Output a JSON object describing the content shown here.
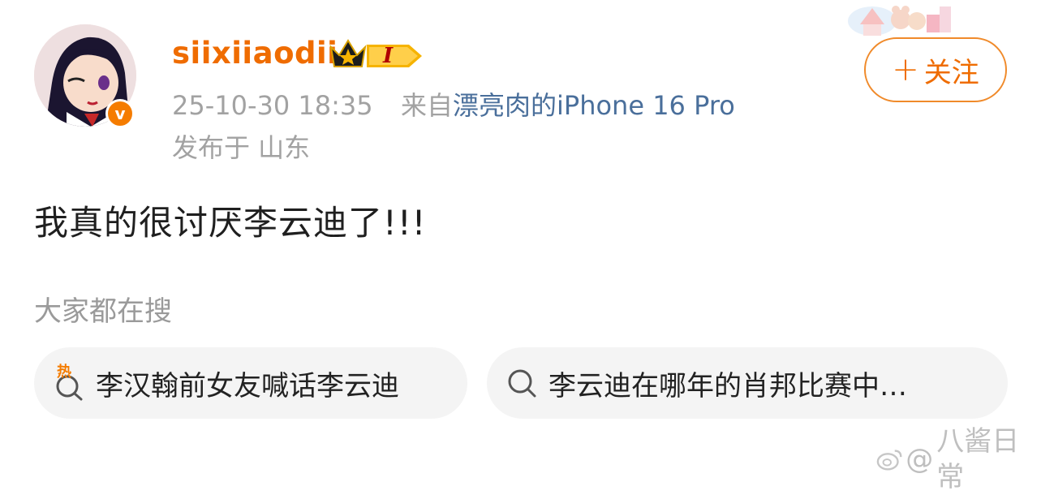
{
  "author": {
    "username": "siixiiaodii",
    "level_badge": "I"
  },
  "post_meta": {
    "datetime": "25-10-30 18:35",
    "source_prefix": "来自",
    "device": "漂亮肉的iPhone 16 Pro",
    "location": "发布于 山东"
  },
  "follow_button": {
    "plus": "+",
    "label": "关注"
  },
  "post": {
    "text": "我真的很讨厌李云迪了!!!"
  },
  "search_section": {
    "title": "大家都在搜",
    "chips": [
      {
        "label": "李汉翰前女友喊话李云迪",
        "icon": "hot-search-icon",
        "hot_badge": "热"
      },
      {
        "label": "李云迪在哪年的肖邦比赛中…",
        "icon": "search-icon"
      }
    ]
  },
  "watermark": {
    "prefix": "@",
    "text": "八酱日常"
  },
  "colors": {
    "username": "#ef6c00",
    "device_link": "#4a6f9b",
    "meta_gray": "#a2a2a2",
    "follow_border": "#f08a2a",
    "chip_bg": "#f4f4f4"
  }
}
